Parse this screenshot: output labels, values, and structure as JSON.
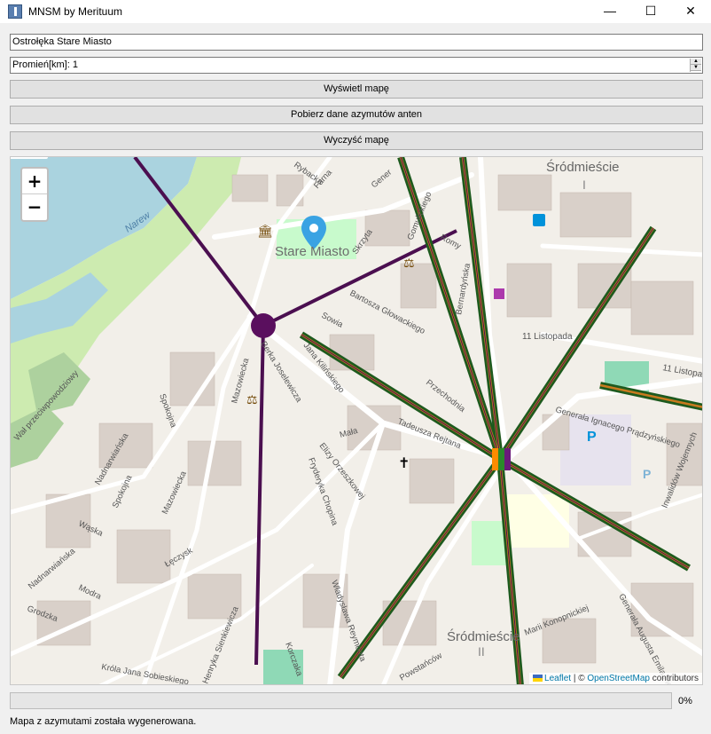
{
  "window": {
    "title": "MNSM by Merituum",
    "min_glyph": "—",
    "max_glyph": "☐",
    "close_glyph": "✕"
  },
  "location_input": {
    "value": "Ostrołęka Stare Miasto"
  },
  "radius_spinbox": {
    "value": "Promień[km]: 1"
  },
  "buttons": {
    "show_map": "Wyświetl mapę",
    "fetch_azimuths": "Pobierz dane azymutów anten",
    "clear_map": "Wyczyść mapę"
  },
  "map": {
    "zoom_in": "+",
    "zoom_out": "−",
    "attribution": {
      "leaflet": "Leaflet",
      "separator": " | © ",
      "osm": "OpenStreetMap",
      "contributors": " contributors"
    },
    "labels": {
      "district_top": "Śródmieście",
      "district_roman_top": "I",
      "district_bottom": "Śródmieście",
      "district_roman_bottom": "II",
      "old_town": "Stare Miasto",
      "river": "Narew",
      "st_listopada": "11 Listopada",
      "st_listopada_2": "11 Listopada",
      "st_pradzynskiego": "Generała Ignacego Prądzyńskiego",
      "st_bartosza": "Bartosza Głowackiego",
      "st_sowia": "Sowia",
      "st_kilinskiego": "Jana Kilińskiego",
      "st_joselewicza": "Berka Joselewicza",
      "st_mazowiecka": "Mazowiecka",
      "st_mazowiecka_2": "Mazowiecka",
      "st_spokojna": "Spokojna",
      "st_spokojna_2": "Spokojna",
      "st_nadnarwianska": "Nadnarwiańska",
      "st_nadnarwianska_2": "Nadnarwiańska",
      "st_walprzeciw": "Wał przeciwpowodziowy",
      "st_orzeszkowej": "Elizy Orzeszkowej",
      "st_chopina": "Fryderyka Chopina",
      "st_mala": "Mała",
      "st_rejtana": "Tadeusza Rejtana",
      "st_przechodnia": "Przechodnia",
      "st_waska": "Wąska",
      "st_modra": "Modra",
      "st_grodzka": "Grodzka",
      "st_leczysk": "Łęczysk",
      "st_sobieskiego": "Króla Jana Sobieskiego",
      "st_sienkiewicza": "Henryka Sienkiewicza",
      "st_korczaka": "Korczaka",
      "st_reymonta": "Władysława Reymonta",
      "st_konopnickiej": "Marii Konopnickiej",
      "st_powstancow": "Powstańców",
      "st_plater": "Generała Augusta Emila Fieldorfa",
      "st_wojennych": "Inwalidów Wojennych",
      "st_gomulickiego": "Gomulickiego",
      "st_romy": "Romy",
      "st_farna": "Farna",
      "st_rybacka": "Rybacka",
      "st_skrzyta": "Skrzyta",
      "st_bernardynska": "Bernardyńska",
      "st_gen": "Gener"
    },
    "colors": {
      "water": "#aad3df",
      "park": "#c8facc",
      "building": "#d9d0c9",
      "road": "#ffffff",
      "azimuth_purple": "#4b0f50",
      "azimuth_green": "#1e5a1e",
      "azimuth_orange": "#c87a1e"
    }
  },
  "progress": {
    "percent": 0,
    "label": "0%"
  },
  "status_text": "Mapa z azymutami została wygenerowana."
}
